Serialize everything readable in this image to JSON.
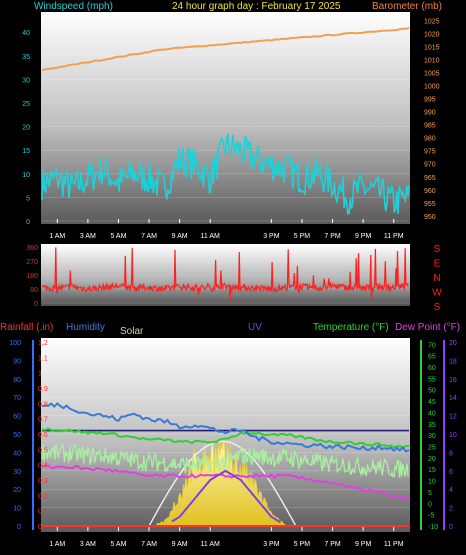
{
  "titles": {
    "windspeed": "Windspeed (mph)",
    "main": "24 hour graph day : February 17 2025",
    "barometer": "Barometer (mb)",
    "rainfall": "Rainfall (.in)",
    "humidity": "Humidity",
    "solar": "Solar",
    "uv": "UV",
    "temperature": "Temperature (°F)",
    "dewpoint": "Dew Point (°F)"
  },
  "colors": {
    "wind": "#20d0d8",
    "barometer": "#f0a050",
    "direction": "#ff2020",
    "rain": "#ff3030",
    "humidity": "#3a7ad8",
    "solar": "#d8d0a0",
    "uv": "#8040e0",
    "temperature": "#30d030",
    "dewpoint": "#e040e0",
    "windTitle": "#20d0d8",
    "mainTitle": "#f0e040",
    "baroTitle": "#f08040",
    "axisBlue": "#3070ff",
    "axisGreen": "#30d030",
    "axisPurple": "#9040ff",
    "compass": "#ff2020"
  },
  "time_labels": [
    "1 AM",
    "3 AM",
    "5 AM",
    "7 AM",
    "9 AM",
    "11 AM",
    "3 PM",
    "5 PM",
    "7 PM",
    "9 PM",
    "11 PM"
  ],
  "wind_ticks": [
    "40",
    "35",
    "30",
    "25",
    "20",
    "15",
    "10",
    "5",
    "0"
  ],
  "baro_ticks": [
    "1025",
    "1020",
    "1015",
    "1010",
    "1005",
    "1000",
    "995",
    "990",
    "985",
    "980",
    "975",
    "970",
    "965",
    "960",
    "955",
    "950"
  ],
  "dir_ticks": [
    "360",
    "270",
    "180",
    "90",
    "0"
  ],
  "compass": [
    "S",
    "E",
    "N",
    "W",
    "S"
  ],
  "rain_ticks": [
    "1.2",
    "1.1",
    "1",
    "0.9",
    "0.8",
    "0.7",
    "0.6",
    "0.5",
    "0.4",
    "0.3",
    "0.2",
    "0.1",
    "0"
  ],
  "hum_ticks": [
    "100",
    "90",
    "80",
    "70",
    "60",
    "50",
    "40",
    "30",
    "20",
    "10",
    "0"
  ],
  "temp_ticks": [
    "70",
    "65",
    "60",
    "55",
    "50",
    "45",
    "40",
    "35",
    "30",
    "25",
    "20",
    "15",
    "10",
    "5",
    "0",
    "-5",
    "-10"
  ],
  "uv_ticks": [
    "20",
    "18",
    "16",
    "14",
    "12",
    "10",
    "8",
    "6",
    "4",
    "2",
    "0"
  ],
  "chart_data": [
    {
      "type": "line",
      "title": "24 hour graph day : February 17 2025",
      "x": [
        0,
        1,
        2,
        3,
        4,
        5,
        6,
        7,
        8,
        9,
        10,
        11,
        12,
        13,
        14,
        15,
        16,
        17,
        18,
        19,
        20,
        21,
        22,
        23,
        24
      ],
      "series": [
        {
          "name": "Windspeed (mph)",
          "axis": "left",
          "ylim": [
            0,
            43
          ],
          "values": [
            8,
            9,
            7,
            9,
            11,
            8,
            10,
            9,
            7,
            13,
            12,
            9,
            16,
            15,
            13,
            12,
            11,
            9,
            10,
            8,
            5,
            7,
            6,
            4,
            5
          ]
        },
        {
          "name": "Barometer (mb)",
          "axis": "right",
          "ylim": [
            948,
            1026
          ],
          "values": [
            1006,
            1007,
            1008,
            1009,
            1010,
            1011,
            1012,
            1013,
            1014,
            1014.5,
            1015,
            1015.5,
            1016,
            1016.5,
            1017,
            1017.5,
            1018,
            1018.5,
            1019,
            1019.5,
            1020,
            1020.5,
            1021,
            1021.5,
            1022
          ]
        }
      ]
    },
    {
      "type": "scatter",
      "series": [
        {
          "name": "Wind direction",
          "ylim": [
            0,
            360
          ],
          "values": [
            100,
            95,
            105,
            90,
            100,
            110,
            95,
            100,
            90,
            105,
            100,
            95,
            110,
            100,
            95,
            90,
            100,
            105,
            95,
            110,
            100,
            95,
            105,
            100,
            110
          ]
        }
      ],
      "right_labels": [
        "S",
        "E",
        "N",
        "W",
        "S"
      ]
    },
    {
      "type": "line",
      "x": [
        0,
        1,
        2,
        3,
        4,
        5,
        6,
        7,
        8,
        9,
        10,
        11,
        12,
        13,
        14,
        15,
        16,
        17,
        18,
        19,
        20,
        21,
        22,
        23,
        24
      ],
      "series": [
        {
          "name": "Rainfall (.in)",
          "axis": "left-outer",
          "ylim": [
            0,
            1.2
          ],
          "values": [
            0,
            0,
            0,
            0,
            0,
            0,
            0,
            0,
            0,
            0,
            0,
            0,
            0,
            0,
            0,
            0,
            0,
            0,
            0,
            0,
            0,
            0,
            0,
            0,
            0
          ]
        },
        {
          "name": "Humidity",
          "axis": "left-inner",
          "ylim": [
            0,
            100
          ],
          "values": [
            65,
            66,
            64,
            61,
            60,
            58,
            61,
            58,
            57,
            54,
            55,
            53,
            51,
            52,
            48,
            46,
            45,
            44,
            44,
            43,
            43,
            42,
            43,
            42,
            41
          ]
        },
        {
          "name": "Solar",
          "axis": "none",
          "values": [
            0,
            0,
            0,
            0,
            0,
            0,
            0,
            0,
            0.05,
            0.35,
            0.85,
            0.95,
            0.9,
            0.75,
            0.5,
            0.15,
            0,
            0,
            0,
            0,
            0,
            0,
            0,
            0,
            0
          ]
        },
        {
          "name": "UV",
          "axis": "right-outer",
          "ylim": [
            0,
            20
          ],
          "values": [
            0,
            0,
            0,
            0,
            0,
            0,
            0,
            0,
            0,
            1,
            3,
            5,
            6,
            5,
            3,
            1,
            0,
            0,
            0,
            0,
            0,
            0,
            0,
            0,
            0
          ]
        },
        {
          "name": "Temperature (°F)",
          "axis": "right-inner",
          "ylim": [
            -10,
            71
          ],
          "values": [
            33,
            32,
            32,
            31,
            31,
            30,
            29,
            28,
            28,
            27,
            27,
            27,
            28,
            31,
            31,
            30,
            30,
            29,
            28,
            27,
            27,
            26,
            26,
            25,
            25
          ]
        },
        {
          "name": "Dew Point (°F)",
          "axis": "right-inner",
          "ylim": [
            -10,
            71
          ],
          "values": [
            16,
            16,
            16,
            15,
            15,
            14,
            13,
            12,
            12,
            12,
            12,
            12,
            12,
            12,
            12,
            12,
            12,
            11,
            10,
            9,
            7,
            6,
            5,
            3,
            2
          ]
        }
      ],
      "reference_line": {
        "value": 32,
        "axis": "right-inner",
        "color": "#202070"
      }
    }
  ]
}
